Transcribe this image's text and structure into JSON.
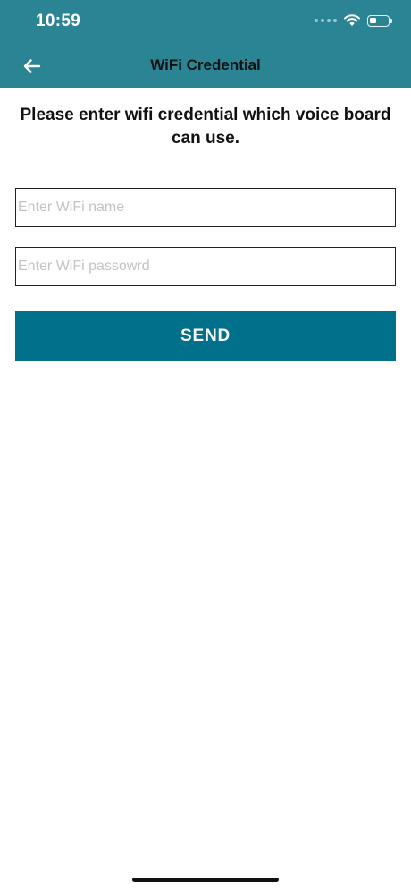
{
  "status_bar": {
    "time": "10:59",
    "battery_level": 0.4
  },
  "nav": {
    "title": "WiFi Credential",
    "back_icon": "arrow-left-icon"
  },
  "content": {
    "prompt": "Please enter wifi credential which voice board can use.",
    "wifi_name_placeholder": "Enter WiFi name",
    "wifi_name_value": "",
    "wifi_password_placeholder": "Enter WiFi passowrd",
    "wifi_password_value": "",
    "send_label": "SEND"
  },
  "colors": {
    "header_bg": "#2a8494",
    "button_bg": "#01708a",
    "button_text": "#ffffff"
  }
}
